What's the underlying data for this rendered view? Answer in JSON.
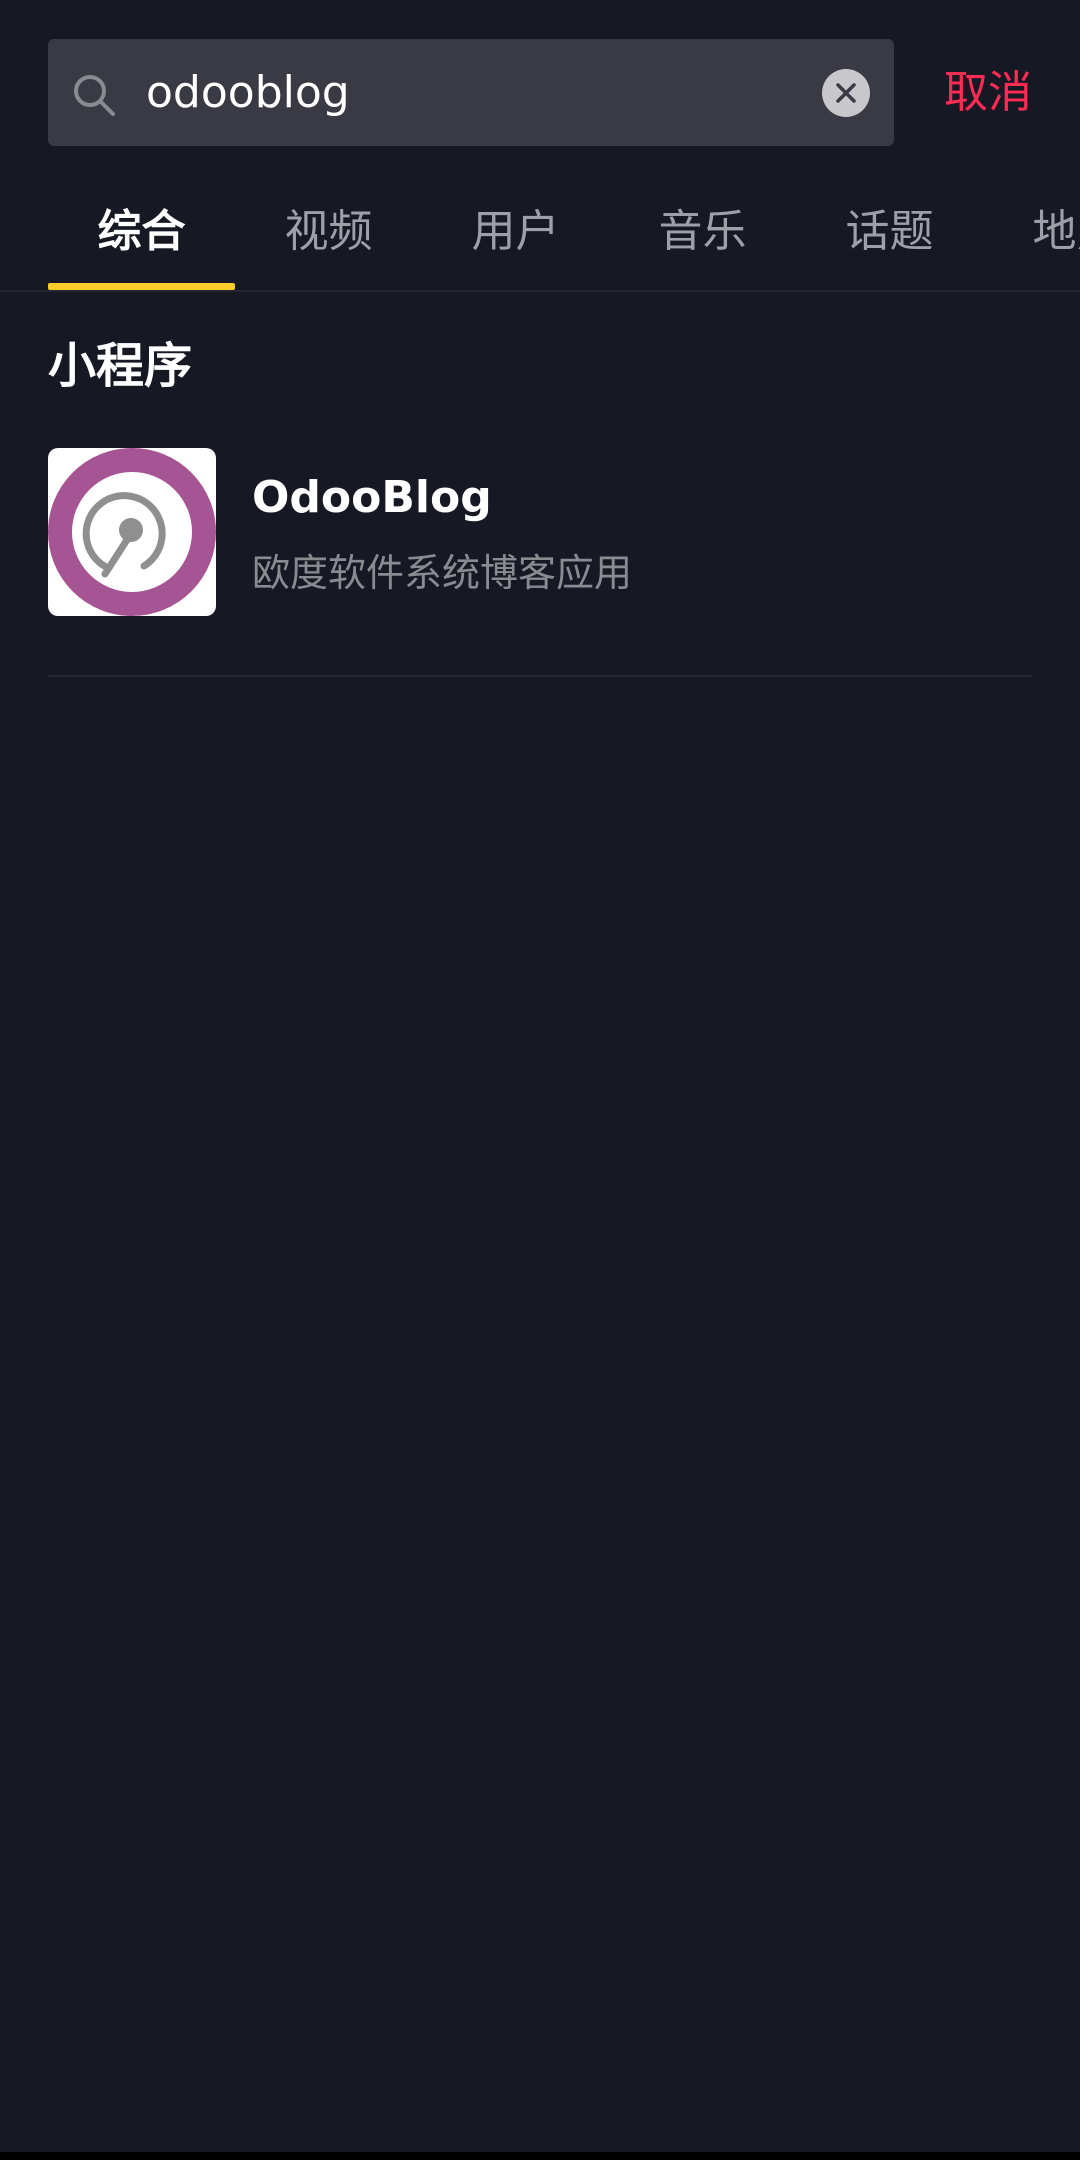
{
  "search": {
    "query": "odooblog",
    "cancel_label": "取消"
  },
  "tabs": [
    {
      "label": "综合",
      "active": true
    },
    {
      "label": "视频",
      "active": false
    },
    {
      "label": "用户",
      "active": false
    },
    {
      "label": "音乐",
      "active": false
    },
    {
      "label": "话题",
      "active": false
    },
    {
      "label": "地点",
      "active": false
    }
  ],
  "section": {
    "title": "小程序"
  },
  "results": [
    {
      "name": "OdooBlog",
      "description": "欧度软件系统博客应用",
      "logo_icon": "odooblog-logo-icon"
    }
  ],
  "colors": {
    "background": "#161823",
    "accent": "#fe2c55",
    "tab_indicator": "#facd2a",
    "logo_ring": "#a55594",
    "logo_mark": "#8f8f8f"
  }
}
